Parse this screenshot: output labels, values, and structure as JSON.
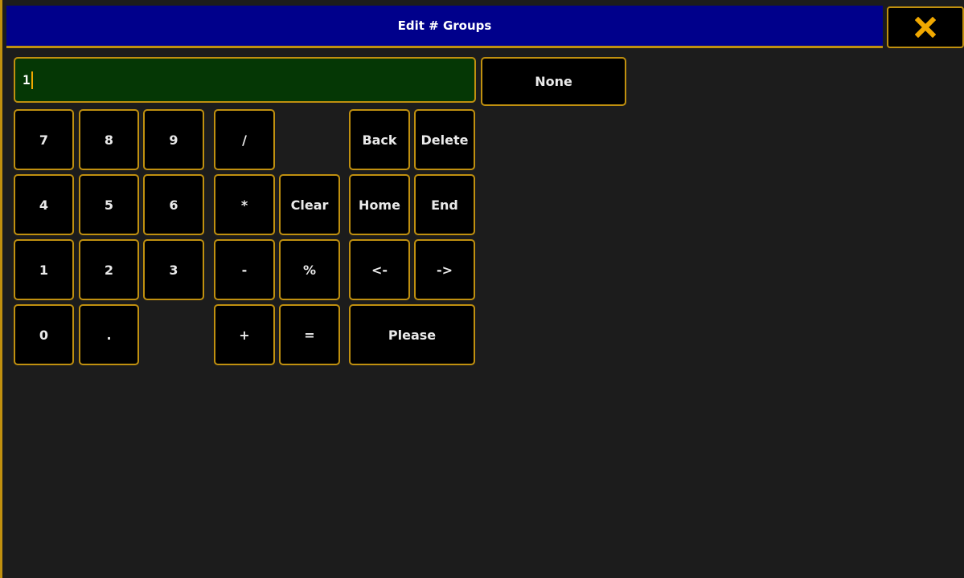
{
  "window": {
    "title": "Edit # Groups"
  },
  "input": {
    "value": "1"
  },
  "preset": {
    "none_label": "None"
  },
  "keypad": {
    "k7": "7",
    "k8": "8",
    "k9": "9",
    "k4": "4",
    "k5": "5",
    "k6": "6",
    "k1": "1",
    "k2": "2",
    "k3": "3",
    "k0": "0",
    "dot": ".",
    "divide": "/",
    "multiply": "*",
    "minus": "-",
    "plus": "+",
    "clear": "Clear",
    "percent": "%",
    "equals": "=",
    "back": "Back",
    "delete": "Delete",
    "home": "Home",
    "end": "End",
    "left": "<-",
    "right": "->",
    "please": "Please"
  },
  "colors": {
    "accent_border": "#c0900f",
    "title_bar": "#00008b",
    "input_background": "#053705",
    "close_icon": "#f0a800"
  }
}
